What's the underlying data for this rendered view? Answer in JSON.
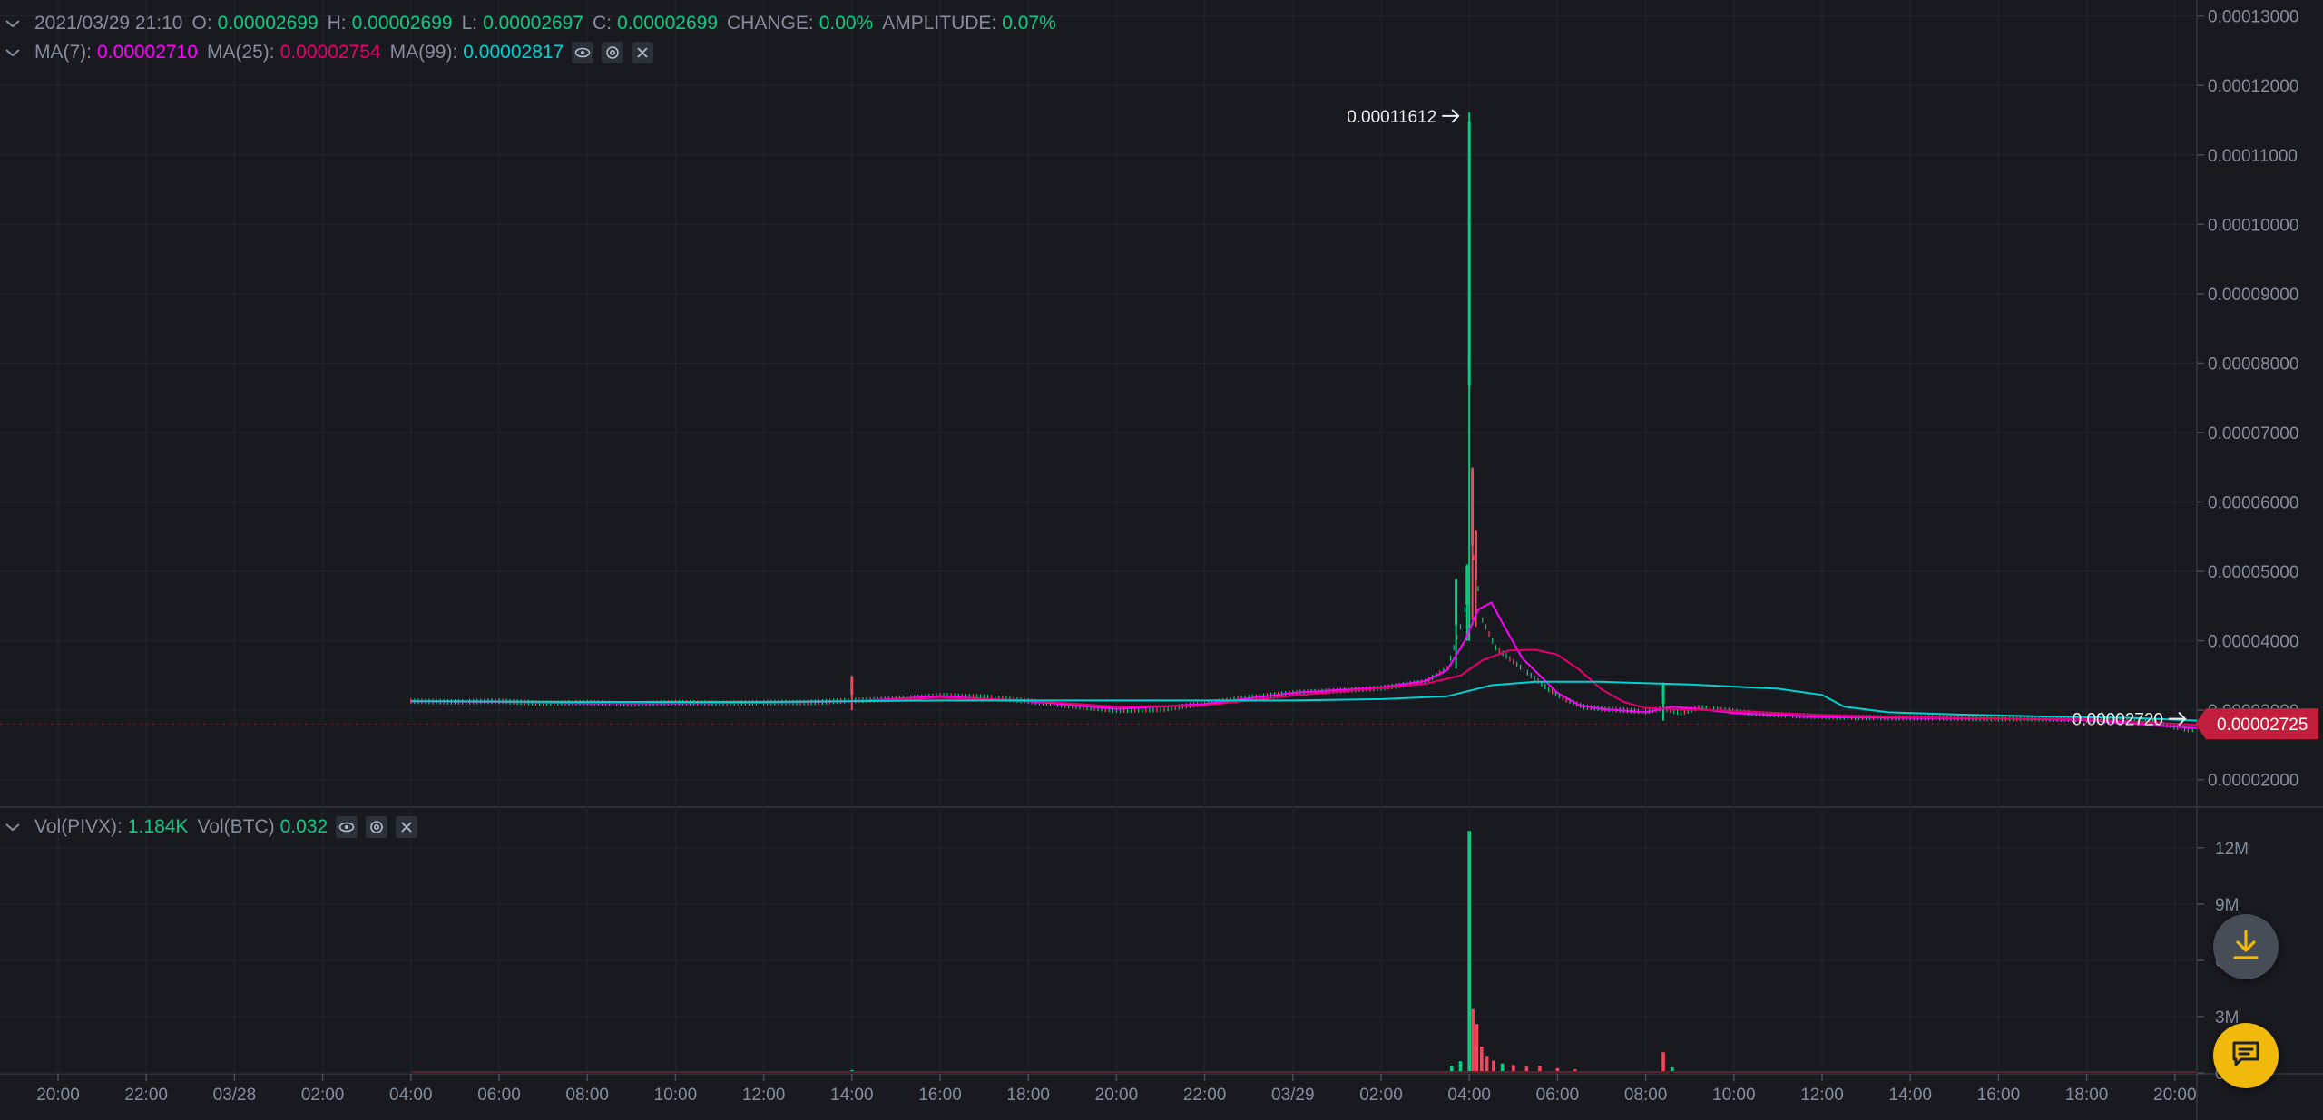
{
  "ohlc": {
    "datetime": "2021/03/29 21:10",
    "open_label": "O:",
    "open": "0.00002699",
    "high_label": "H:",
    "high": "0.00002699",
    "low_label": "L:",
    "low": "0.00002697",
    "close_label": "C:",
    "close": "0.00002699",
    "change_label": "CHANGE:",
    "change": "0.00%",
    "amplitude_label": "AMPLITUDE:",
    "amplitude": "0.07%"
  },
  "ma": {
    "ma7_label": "MA(7):",
    "ma7": "0.00002710",
    "ma25_label": "MA(25):",
    "ma25": "0.00002754",
    "ma99_label": "MA(99):",
    "ma99": "0.00002817"
  },
  "vol": {
    "pivx_label": "Vol(PIVX):",
    "pivx": "1.184K",
    "btc_label": "Vol(BTC)",
    "btc": "0.032"
  },
  "icons": [
    "chevron-down-icon",
    "eye-icon",
    "settings-icon",
    "close-icon",
    "download-icon",
    "chat-icon"
  ],
  "colors": {
    "background": "#181a20",
    "up": "#0ecb81",
    "down": "#f6465d",
    "ma7": "#ff00ff",
    "ma25": "#e6006e",
    "ma99": "#00d2d2",
    "current_price_tag": "#c11f3d",
    "fab_chat": "#f0b90b"
  },
  "chart_data": [
    {
      "type": "candlestick",
      "pane": "price",
      "y_ticks": [
        "0.00013000",
        "0.00012000",
        "0.00011000",
        "0.00010000",
        "0.00009000",
        "0.00008000",
        "0.00007000",
        "0.00006000",
        "0.00005000",
        "0.00004000",
        "0.00003000",
        "0.00002000"
      ],
      "ylim": [
        1.8e-05,
        0.000131
      ],
      "x_ticks": [
        "20:00",
        "22:00",
        "03/28",
        "02:00",
        "04:00",
        "06:00",
        "08:00",
        "10:00",
        "12:00",
        "14:00",
        "16:00",
        "18:00",
        "20:00",
        "22:00",
        "03/29",
        "02:00",
        "04:00",
        "06:00",
        "08:00",
        "10:00",
        "12:00",
        "14:00",
        "16:00",
        "18:00",
        "20:00"
      ],
      "x_hours": [
        -4,
        -2,
        0,
        2,
        4,
        6,
        8,
        10,
        12,
        14,
        16,
        18,
        20,
        22,
        24,
        26,
        28,
        30,
        32,
        34,
        36,
        38,
        40,
        42,
        44
      ],
      "high_marker": {
        "label": "0.00011612",
        "hour": 28.0,
        "value": 0.00011612
      },
      "low_marker": {
        "label": "0.00002720",
        "hour": 44.3,
        "value": 2.72e-05
      },
      "current_price": {
        "label": "0.00002725",
        "value": 2.725e-05
      },
      "close_series": [
        [
          4.0,
          3.13e-05
        ],
        [
          5.0,
          3.12e-05
        ],
        [
          6.0,
          3.13e-05
        ],
        [
          7.0,
          3.1e-05
        ],
        [
          8.0,
          3.11e-05
        ],
        [
          9.0,
          3.09e-05
        ],
        [
          10.0,
          3.11e-05
        ],
        [
          11.0,
          3.1e-05
        ],
        [
          12.0,
          3.11e-05
        ],
        [
          13.0,
          3.11e-05
        ],
        [
          14.0,
          3.14e-05
        ],
        [
          15.0,
          3.16e-05
        ],
        [
          16.0,
          3.21e-05
        ],
        [
          17.0,
          3.19e-05
        ],
        [
          18.0,
          3.13e-05
        ],
        [
          19.0,
          3.06e-05
        ],
        [
          20.0,
          3e-05
        ],
        [
          21.0,
          3.01e-05
        ],
        [
          22.0,
          3.1e-05
        ],
        [
          23.0,
          3.18e-05
        ],
        [
          24.0,
          3.25e-05
        ],
        [
          25.0,
          3.28e-05
        ],
        [
          26.0,
          3.32e-05
        ],
        [
          27.0,
          3.41e-05
        ],
        [
          27.5,
          3.6e-05
        ],
        [
          27.8,
          4.2e-05
        ],
        [
          28.0,
          4.7e-05
        ],
        [
          28.1,
          5.2e-05
        ],
        [
          28.3,
          4.3e-05
        ],
        [
          28.6,
          3.9e-05
        ],
        [
          29.0,
          3.7e-05
        ],
        [
          29.4,
          3.5e-05
        ],
        [
          29.8,
          3.3e-05
        ],
        [
          30.2,
          3.15e-05
        ],
        [
          30.6,
          3.05e-05
        ],
        [
          31.0,
          3.02e-05
        ],
        [
          32.0,
          2.98e-05
        ],
        [
          32.4,
          3.03e-05
        ],
        [
          32.8,
          2.96e-05
        ],
        [
          33.2,
          3.04e-05
        ],
        [
          33.8,
          3e-05
        ],
        [
          34.5,
          2.95e-05
        ],
        [
          35.5,
          2.92e-05
        ],
        [
          36.5,
          2.9e-05
        ],
        [
          37.5,
          2.89e-05
        ],
        [
          38.5,
          2.89e-05
        ],
        [
          39.5,
          2.88e-05
        ],
        [
          40.5,
          2.88e-05
        ],
        [
          41.5,
          2.87e-05
        ],
        [
          42.5,
          2.85e-05
        ],
        [
          43.5,
          2.83e-05
        ],
        [
          44.3,
          2.72e-05
        ],
        [
          44.5,
          2.73e-05
        ]
      ],
      "spikes": [
        {
          "hour": 14.0,
          "high": 3.5e-05,
          "low": 3e-05
        },
        {
          "hour": 27.7,
          "high": 4.9e-05,
          "low": 3.6e-05
        },
        {
          "hour": 27.95,
          "high": 5.1e-05,
          "low": 4e-05
        },
        {
          "hour": 28.0,
          "high": 0.00011612,
          "low": 4e-05
        },
        {
          "hour": 28.07,
          "high": 6.5e-05,
          "low": 4.3e-05
        },
        {
          "hour": 28.15,
          "high": 5.6e-05,
          "low": 4.2e-05
        },
        {
          "hour": 32.4,
          "high": 3.4e-05,
          "low": 2.85e-05
        }
      ],
      "series": [
        {
          "name": "MA(7)",
          "color": "#ff00ff",
          "values": [
            [
              4.0,
              3.13e-05
            ],
            [
              6.0,
              3.12e-05
            ],
            [
              8.0,
              3.1e-05
            ],
            [
              10.0,
              3.1e-05
            ],
            [
              12.0,
              3.11e-05
            ],
            [
              14.0,
              3.13e-05
            ],
            [
              16.0,
              3.2e-05
            ],
            [
              18.0,
              3.13e-05
            ],
            [
              20.0,
              3.02e-05
            ],
            [
              22.0,
              3.09e-05
            ],
            [
              24.0,
              3.25e-05
            ],
            [
              26.0,
              3.33e-05
            ],
            [
              27.0,
              3.42e-05
            ],
            [
              27.5,
              3.58e-05
            ],
            [
              27.9,
              4e-05
            ],
            [
              28.2,
              4.45e-05
            ],
            [
              28.5,
              4.55e-05
            ],
            [
              28.8,
              4.2e-05
            ],
            [
              29.2,
              3.75e-05
            ],
            [
              29.6,
              3.5e-05
            ],
            [
              30.0,
              3.25e-05
            ],
            [
              30.5,
              3.07e-05
            ],
            [
              31.0,
              3.02e-05
            ],
            [
              32.0,
              2.97e-05
            ],
            [
              32.6,
              3.05e-05
            ],
            [
              33.2,
              3.02e-05
            ],
            [
              34.0,
              2.96e-05
            ],
            [
              36.0,
              2.9e-05
            ],
            [
              38.0,
              2.89e-05
            ],
            [
              40.0,
              2.88e-05
            ],
            [
              42.0,
              2.86e-05
            ],
            [
              44.5,
              2.74e-05
            ]
          ]
        },
        {
          "name": "MA(25)",
          "color": "#e6006e",
          "values": [
            [
              4.0,
              3.13e-05
            ],
            [
              6.0,
              3.12e-05
            ],
            [
              8.0,
              3.11e-05
            ],
            [
              10.0,
              3.11e-05
            ],
            [
              12.0,
              3.11e-05
            ],
            [
              14.0,
              3.13e-05
            ],
            [
              16.0,
              3.18e-05
            ],
            [
              18.0,
              3.14e-05
            ],
            [
              20.0,
              3.05e-05
            ],
            [
              22.0,
              3.07e-05
            ],
            [
              24.0,
              3.21e-05
            ],
            [
              26.0,
              3.32e-05
            ],
            [
              27.0,
              3.38e-05
            ],
            [
              27.8,
              3.5e-05
            ],
            [
              28.3,
              3.72e-05
            ],
            [
              28.9,
              3.86e-05
            ],
            [
              29.5,
              3.87e-05
            ],
            [
              30.0,
              3.8e-05
            ],
            [
              30.5,
              3.58e-05
            ],
            [
              31.0,
              3.3e-05
            ],
            [
              31.5,
              3.12e-05
            ],
            [
              32.0,
              3.03e-05
            ],
            [
              33.0,
              3.01e-05
            ],
            [
              34.0,
              2.99e-05
            ],
            [
              36.0,
              2.93e-05
            ],
            [
              38.0,
              2.9e-05
            ],
            [
              40.0,
              2.88e-05
            ],
            [
              42.0,
              2.87e-05
            ],
            [
              44.5,
              2.79e-05
            ]
          ]
        },
        {
          "name": "MA(99)",
          "color": "#00d2d2",
          "values": [
            [
              4.0,
              3.13e-05
            ],
            [
              8.0,
              3.12e-05
            ],
            [
              12.0,
              3.12e-05
            ],
            [
              16.0,
              3.14e-05
            ],
            [
              20.0,
              3.14e-05
            ],
            [
              24.0,
              3.14e-05
            ],
            [
              26.0,
              3.16e-05
            ],
            [
              27.5,
              3.2e-05
            ],
            [
              28.0,
              3.28e-05
            ],
            [
              28.5,
              3.36e-05
            ],
            [
              29.5,
              3.41e-05
            ],
            [
              31.0,
              3.41e-05
            ],
            [
              33.0,
              3.37e-05
            ],
            [
              35.0,
              3.31e-05
            ],
            [
              36.0,
              3.22e-05
            ],
            [
              36.5,
              3.05e-05
            ],
            [
              37.5,
              2.97e-05
            ],
            [
              39.0,
              2.94e-05
            ],
            [
              41.0,
              2.91e-05
            ],
            [
              43.0,
              2.89e-05
            ],
            [
              44.5,
              2.85e-05
            ]
          ]
        }
      ]
    },
    {
      "type": "bar",
      "pane": "volume",
      "y_ticks": [
        "12M",
        "9M",
        "6M",
        "3M",
        "0"
      ],
      "ylim": [
        0,
        13200000
      ],
      "bars": [
        {
          "hour": 14.0,
          "value": 150000,
          "dir": "up"
        },
        {
          "hour": 27.6,
          "value": 380000,
          "dir": "up"
        },
        {
          "hour": 27.8,
          "value": 620000,
          "dir": "up"
        },
        {
          "hour": 28.0,
          "value": 12900000,
          "dir": "up"
        },
        {
          "hour": 28.08,
          "value": 3400000,
          "dir": "down"
        },
        {
          "hour": 28.17,
          "value": 2600000,
          "dir": "down"
        },
        {
          "hour": 28.28,
          "value": 1400000,
          "dir": "down"
        },
        {
          "hour": 28.4,
          "value": 900000,
          "dir": "down"
        },
        {
          "hour": 28.55,
          "value": 650000,
          "dir": "down"
        },
        {
          "hour": 28.75,
          "value": 500000,
          "dir": "up"
        },
        {
          "hour": 29.0,
          "value": 420000,
          "dir": "down"
        },
        {
          "hour": 29.3,
          "value": 330000,
          "dir": "down"
        },
        {
          "hour": 29.6,
          "value": 380000,
          "dir": "down"
        },
        {
          "hour": 30.0,
          "value": 250000,
          "dir": "down"
        },
        {
          "hour": 30.4,
          "value": 180000,
          "dir": "down"
        },
        {
          "hour": 32.4,
          "value": 1100000,
          "dir": "down"
        },
        {
          "hour": 32.6,
          "value": 300000,
          "dir": "up"
        }
      ]
    }
  ]
}
